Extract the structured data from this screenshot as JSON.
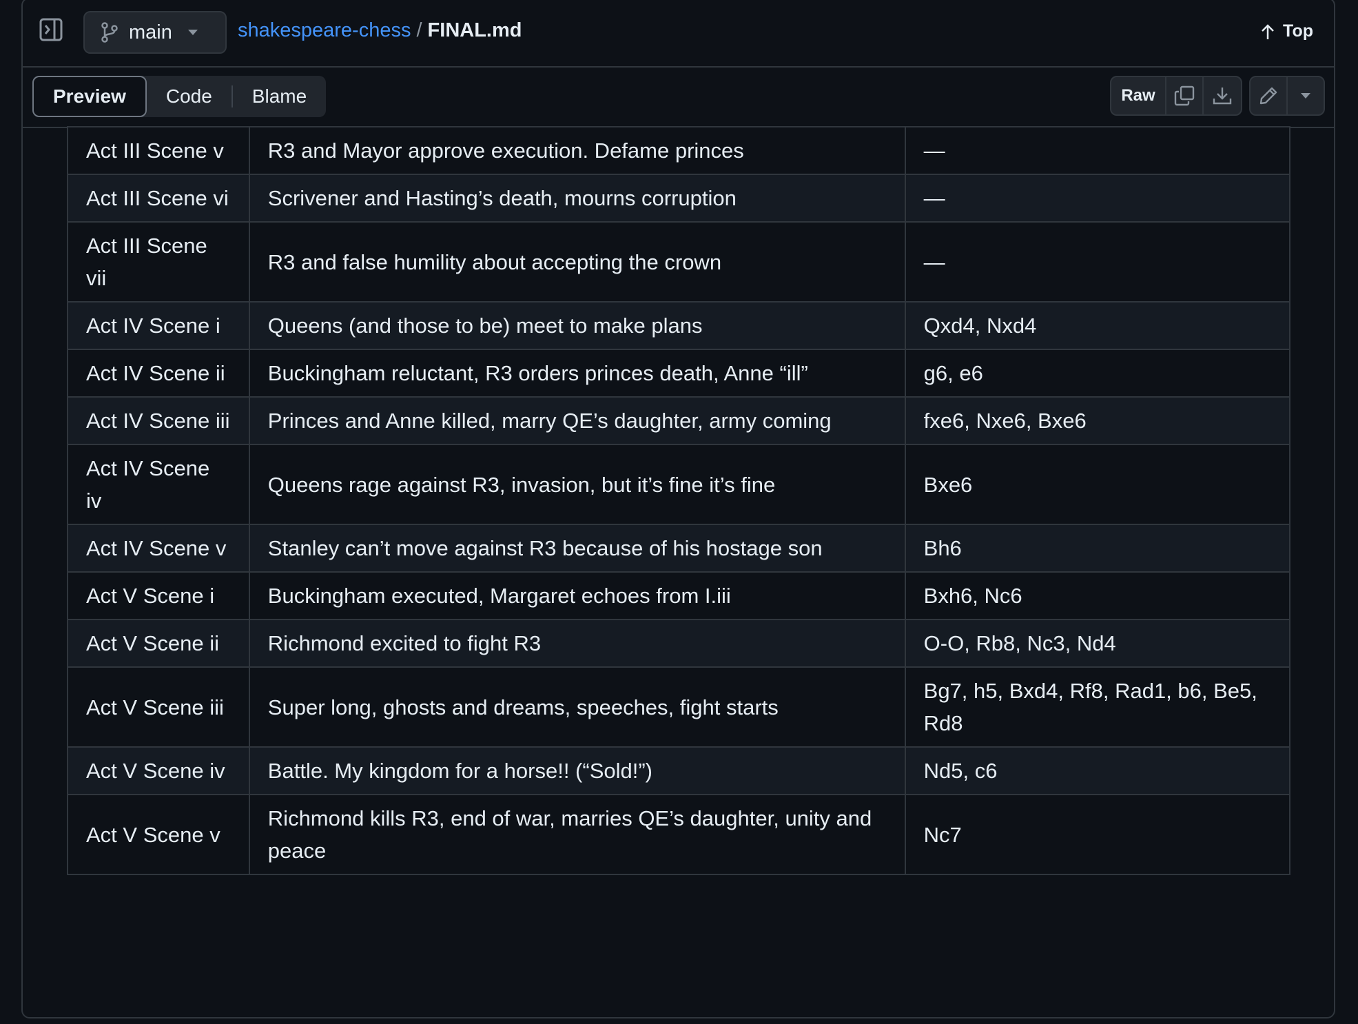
{
  "header": {
    "branch": "main",
    "repo": "shakespeare-chess",
    "separator": "/",
    "file": "FINAL.md",
    "top_label": "Top"
  },
  "toolbar": {
    "tabs": [
      "Preview",
      "Code",
      "Blame"
    ],
    "active_tab": "Preview",
    "raw_label": "Raw"
  },
  "table": {
    "rows": [
      [
        "Act III Scene v",
        "R3 and Mayor approve execution. Defame princes",
        "—"
      ],
      [
        "Act III Scene vi",
        "Scrivener and Hasting’s death, mourns corruption",
        "—"
      ],
      [
        "Act III Scene vii",
        "R3 and false humility about accepting the crown",
        "—"
      ],
      [
        "Act IV Scene i",
        "Queens (and those to be) meet to make plans",
        "Qxd4, Nxd4"
      ],
      [
        "Act IV Scene ii",
        "Buckingham reluctant, R3 orders princes death, Anne “ill”",
        "g6, e6"
      ],
      [
        "Act IV Scene iii",
        "Princes and Anne killed, marry QE’s daughter, army coming",
        "fxe6, Nxe6, Bxe6"
      ],
      [
        "Act IV Scene iv",
        "Queens rage against R3, invasion, but it’s fine it’s fine",
        "Bxe6"
      ],
      [
        "Act IV Scene v",
        "Stanley can’t move against R3 because of his hostage son",
        "Bh6"
      ],
      [
        "Act V Scene i",
        "Buckingham executed, Margaret echoes from I.iii",
        "Bxh6, Nc6"
      ],
      [
        "Act V Scene ii",
        "Richmond excited to fight R3",
        "O-O, Rb8, Nc3, Nd4"
      ],
      [
        "Act V Scene iii",
        "Super long, ghosts and dreams, speeches, fight starts",
        "Bg7, h5, Bxd4, Rf8, Rad1, b6, Be5, Rd8"
      ],
      [
        "Act V Scene iv",
        "Battle. My kingdom for a horse!! (“Sold!”)",
        "Nd5, c6"
      ],
      [
        "Act V Scene v",
        "Richmond kills R3, end of war, marries QE’s daughter, unity and peace",
        "Nc7"
      ]
    ]
  }
}
